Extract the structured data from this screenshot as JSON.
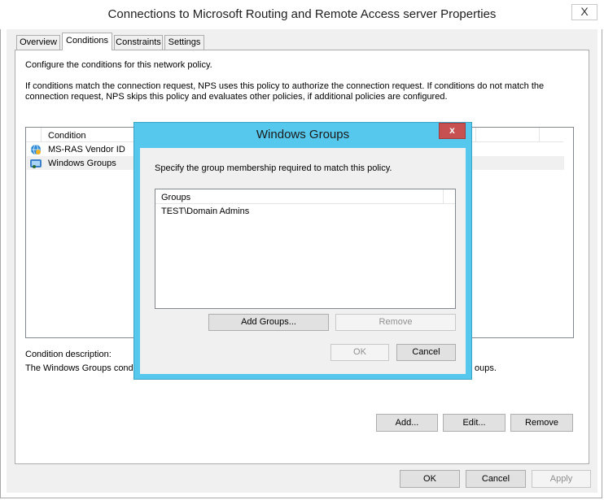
{
  "window": {
    "title": "Connections to Microsoft Routing and Remote Access server Properties",
    "close_glyph": "X"
  },
  "tabs": [
    {
      "label": "Overview",
      "active": false
    },
    {
      "label": "Conditions",
      "active": true
    },
    {
      "label": "Constraints",
      "active": false
    },
    {
      "label": "Settings",
      "active": false
    }
  ],
  "conditions_tab": {
    "intro": "Configure the conditions for this network policy.",
    "description_line1": "If conditions match the connection request, NPS uses this policy to authorize the connection request. If conditions do not match the",
    "description_line2": "connection request, NPS skips this policy and evaluates other policies, if additional policies are configured.",
    "list_header": "Condition",
    "conditions": [
      {
        "label": "MS-RAS Vendor ID",
        "icon": "globe-person-icon"
      },
      {
        "label": "Windows Groups",
        "icon": "windows-group-icon"
      }
    ],
    "condition_description_label": "Condition description:",
    "condition_description_text": "The Windows Groups condi",
    "condition_description_tail": "oups.",
    "add_label": "Add...",
    "edit_label": "Edit...",
    "remove_label": "Remove"
  },
  "footer": {
    "ok_label": "OK",
    "cancel_label": "Cancel",
    "apply_label": "Apply"
  },
  "dialog": {
    "title": "Windows Groups",
    "close_glyph": "x",
    "instruction": "Specify the group membership required to match this policy.",
    "list_header": "Groups",
    "groups": [
      "TEST\\Domain Admins"
    ],
    "add_groups_label": "Add Groups...",
    "remove_label": "Remove",
    "ok_label": "OK",
    "cancel_label": "Cancel"
  },
  "colors": {
    "dialog_frame": "#57c8ed",
    "dialog_close": "#c75050",
    "selected_row": "#f0f0f0"
  }
}
